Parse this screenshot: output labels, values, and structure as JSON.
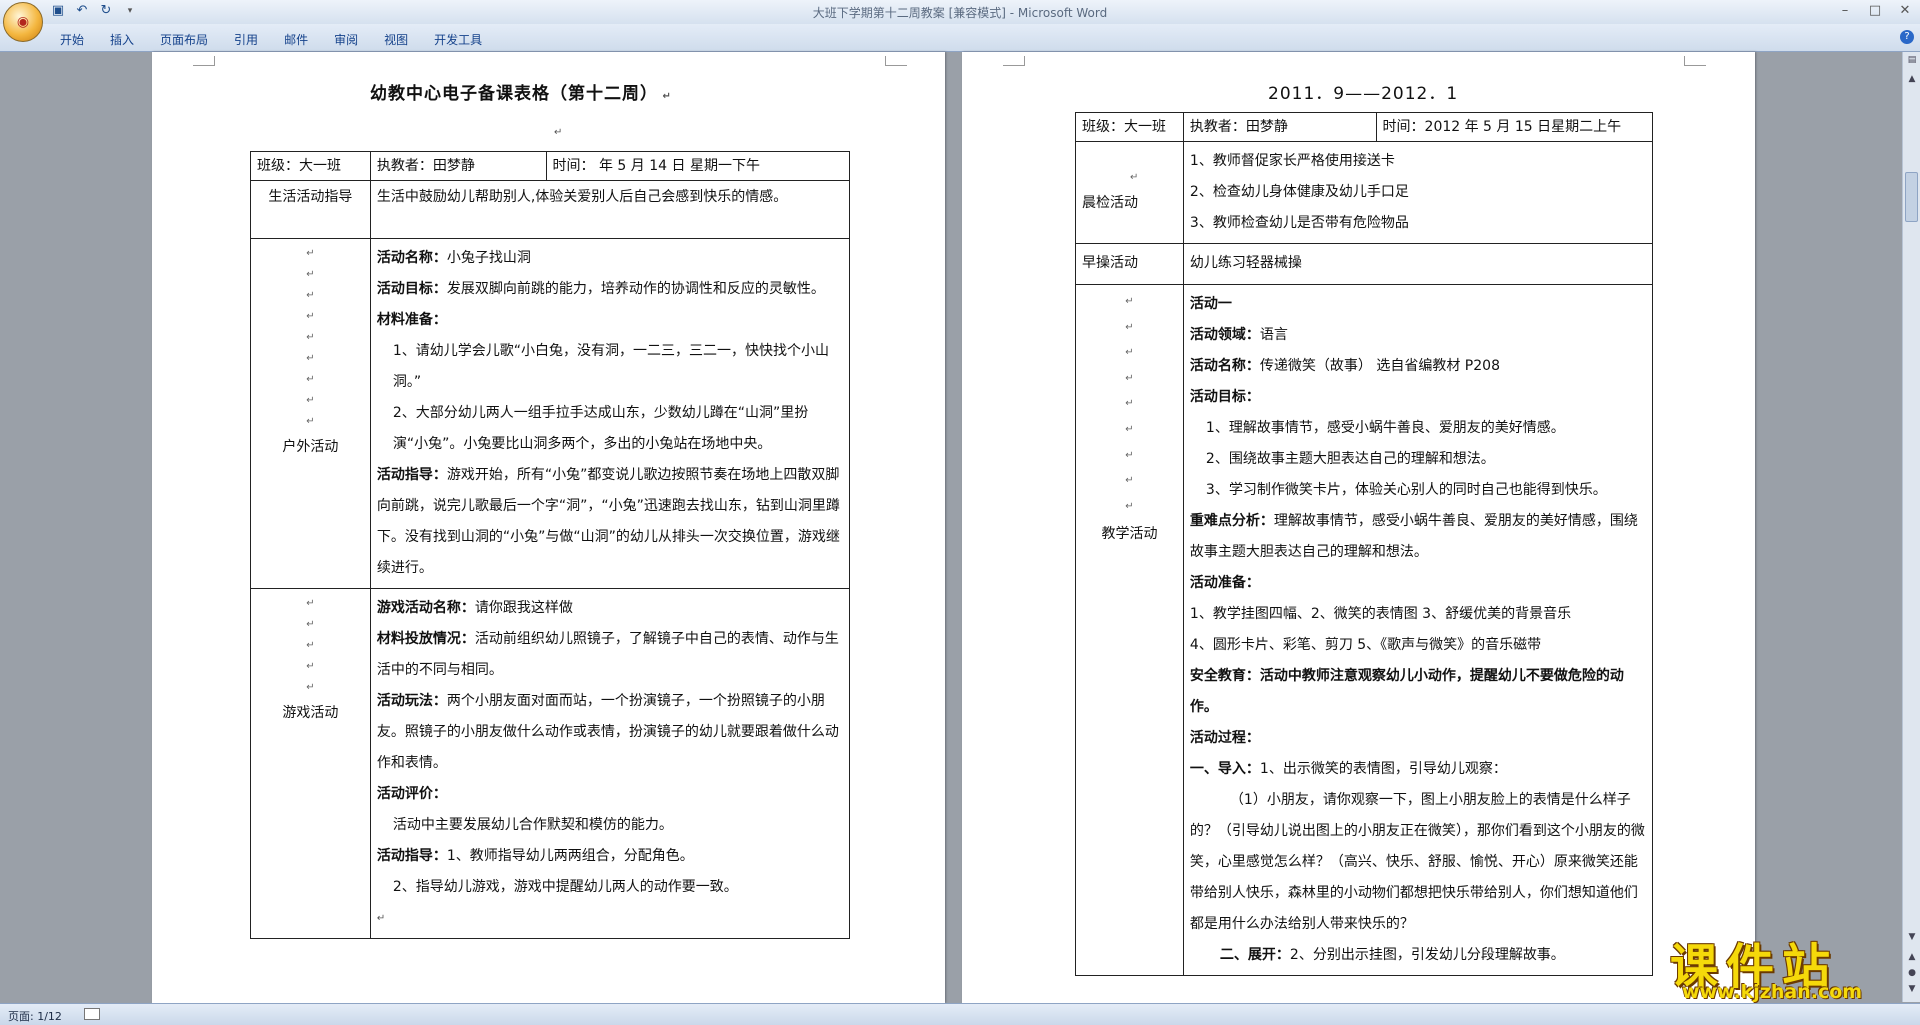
{
  "window": {
    "title": "大班下学期第十二周教案 [兼容模式] - Microsoft Word"
  },
  "ribbon": {
    "tabs": [
      "开始",
      "插入",
      "页面布局",
      "引用",
      "邮件",
      "审阅",
      "视图",
      "开发工具"
    ]
  },
  "status": {
    "page": "页面: 1/12"
  },
  "page1": {
    "title": "幼教中心电子备课表格（第十二周）",
    "header": {
      "class": "班级：大一班",
      "teacher": "执教者：田梦静",
      "time": "时间：      年 5 月 14 日  星期一下午"
    },
    "life": {
      "label": "生活活动指导",
      "text": "生活中鼓励幼儿帮助别人,体验关爱别人后自己会感到快乐的情感。"
    },
    "outdoor": {
      "label": "户外活动",
      "name_label": "活动名称：",
      "name": "小兔子找山洞",
      "goal_label": "活动目标：",
      "goal": "发展双脚向前跳的能力，培养动作的协调性和反应的灵敏性。",
      "prep_label": "材料准备：",
      "prep1": "1、请幼儿学会儿歌“小白兔，没有洞，一二三，三二一，快快找个小山洞。”",
      "prep2": "2、大部分幼儿两人一组手拉手达成山东，少数幼儿蹲在“山洞”里扮演“小兔”。小兔要比山洞多两个，多出的小兔站在场地中央。",
      "guide_label": "活动指导：",
      "guide": "游戏开始，所有“小兔”都变说儿歌边按照节奏在场地上四散双脚向前跳，说完儿歌最后一个字“洞”，“小兔”迅速跑去找山东，钻到山洞里蹲下。没有找到山洞的“小兔”与做“山洞”的幼儿从排头一次交换位置，游戏继续进行。"
    },
    "game": {
      "label": "游戏活动",
      "name_label": "游戏活动名称：",
      "name": "请你跟我这样做",
      "material_label": "材料投放情况：",
      "material": "活动前组织幼儿照镜子，了解镜子中自己的表情、动作与生活中的不同与相同。",
      "play_label": "活动玩法：",
      "play": "两个小朋友面对面而站，一个扮演镜子，一个扮照镜子的小朋友。照镜子的小朋友做什么动作或表情，扮演镜子的幼儿就要跟着做什么动作和表情。",
      "eval_label": "活动评价：",
      "eval": "活动中主要发展幼儿合作默契和模仿的能力。",
      "guide_label": "活动指导：",
      "guide1": "1、教师指导幼儿两两组合，分配角色。",
      "guide2": "2、指导幼儿游戏，游戏中提醒幼儿两人的动作要一致。"
    }
  },
  "page2": {
    "title": "2011．9——2012．1",
    "header": {
      "class": "班级：大一班",
      "teacher": "执教者：田梦静",
      "time": "时间：2012 年 5 月 15 日星期二上午"
    },
    "morning_check": {
      "label": "晨检活动",
      "items": [
        "1、教师督促家长严格使用接送卡",
        "2、检查幼儿身体健康及幼儿手口足",
        "3、教师检查幼儿是否带有危险物品"
      ]
    },
    "morning_exercise": {
      "label": "早操活动",
      "text": "幼儿练习轻器械操"
    },
    "teaching": {
      "label": "教学活动",
      "activity": "活动一",
      "domain_label": "活动领域：",
      "domain": "语言",
      "name_label": "活动名称：",
      "name": "传递微笑（故事）      选自省编教材 P208",
      "goal_label": "活动目标：",
      "goals": [
        "1、理解故事情节，感受小蜗牛善良、爱朋友的美好情感。",
        "2、围绕故事主题大胆表达自己的理解和想法。",
        "3、学习制作微笑卡片，体验关心别人的同时自己也能得到快乐。"
      ],
      "key_label": "重难点分析：",
      "key": "理解故事情节，感受小蜗牛善良、爱朋友的美好情感，围绕故事主题大胆表达自己的理解和想法。",
      "prep_label": "活动准备：",
      "prep1": "1、教学挂图四幅、2、微笑的表情图 3、舒缓优美的背景音乐",
      "prep2": "4、圆形卡片、彩笔、剪刀 5、《歌声与微笑》的音乐磁带",
      "safety": "安全教育：活动中教师注意观察幼儿小动作，提醒幼儿不要做危险的动作。",
      "process_label": "活动过程：",
      "intro_label": "一、导入：",
      "intro": "1、出示微笑的表情图，引导幼儿观察：",
      "intro_q": "（1）小朋友，请你观察一下，图上小朋友脸上的表情是什么样子的？（引导幼儿说出图上的小朋友正在微笑），那你们看到这个小朋友的微笑，心里感觉怎么样？（高兴、快乐、舒服、愉悦、开心）原来微笑还能带给别人快乐，森林里的小动物们都想把快乐带给别人，你们想知道他们都是用什么办法给别人带来快乐的？",
      "expand_label": "二、展开：",
      "expand": "2、分别出示挂图，引发幼儿分段理解故事。"
    }
  },
  "watermark": {
    "big": "课件站",
    "small": "www.kjzhan.com"
  },
  "colors": {
    "ribbon_text": "#15428b",
    "watermark": "#f5d90a"
  }
}
